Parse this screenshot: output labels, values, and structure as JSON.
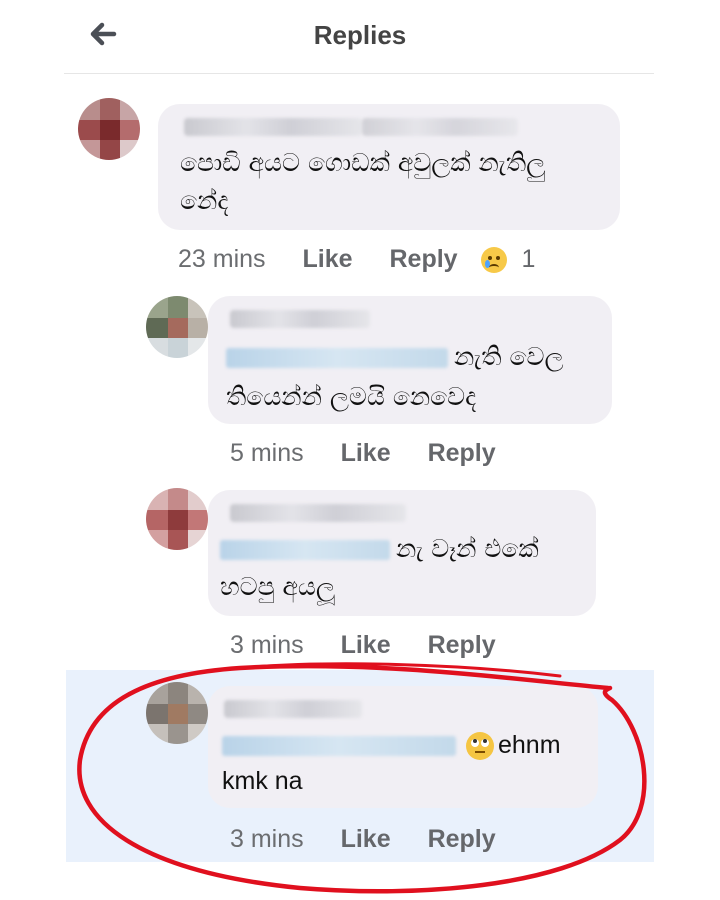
{
  "header": {
    "title": "Replies"
  },
  "comments": [
    {
      "text_lines": [
        "පොඩි අයට ගොඩක් අවුලක් නැතිලු",
        "නේද"
      ],
      "time": "23 mins",
      "like": "Like",
      "reply": "Reply",
      "reaction_count": "1",
      "reaction_icon": "sad-face-icon"
    },
    {
      "text_tail": "නැති වෙල",
      "text_lines": [
        "තියෙන්න් ලමයි නෙවෙද"
      ],
      "time": "5 mins",
      "like": "Like",
      "reply": "Reply"
    },
    {
      "text_tail": "නැ වෑන් එකේ",
      "text_lines": [
        "හටපු අයලූ"
      ],
      "time": "3 mins",
      "like": "Like",
      "reply": "Reply"
    },
    {
      "text_tail": "ehnm",
      "text_lines": [
        "kmk na"
      ],
      "time": "3 mins",
      "like": "Like",
      "reply": "Reply",
      "emoji": "face-with-rolling-eyes-icon"
    }
  ],
  "colors": {
    "highlight": "#e9f1fc",
    "bubble": "#f1eff4",
    "annotation": "#e0101e"
  }
}
